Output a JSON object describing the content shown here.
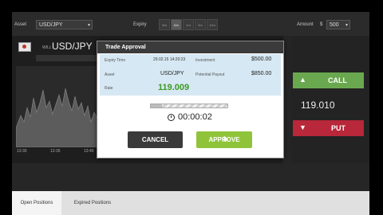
{
  "topbar": {
    "asset_label": "Asset",
    "asset_value": "USD/JPY",
    "expiry_label": "Expiry",
    "expiry_buttons": [
      "30s",
      "60s",
      "2m",
      "5m",
      "10m"
    ],
    "amount_label": "Amount",
    "amount_currency": "$",
    "amount_value": "500"
  },
  "chart": {
    "pair_small": "WILL",
    "pair": "USD/JPY",
    "ticks": [
      "13:30",
      "13:35",
      "13:40"
    ]
  },
  "right": {
    "call_label": "CALL",
    "put_label": "PUT",
    "rate": "119.010"
  },
  "bottom": {
    "tabs": [
      "Open Positions",
      "Expired Positions"
    ]
  },
  "modal": {
    "title": "Trade Approval",
    "expiry_time_label": "Expiry Time",
    "expiry_time_value": "29.02.15 14:20:23",
    "investment_label": "Investment",
    "investment_value": "$500.00",
    "asset_label": "Asset",
    "asset_value": "USD/JPY",
    "payout_label": "Potential Payout",
    "payout_value": "$850.00",
    "rate_label": "Rate",
    "rate_value": "119.009",
    "timer": "00:00:02",
    "progress_fraction": 0.15,
    "cancel_label": "CANCEL",
    "approve_label": "APPROVE"
  },
  "colors": {
    "call": "#6aa84f",
    "put": "#b8273a",
    "approve": "#8fc43a",
    "rate_green": "#3d9a22"
  }
}
